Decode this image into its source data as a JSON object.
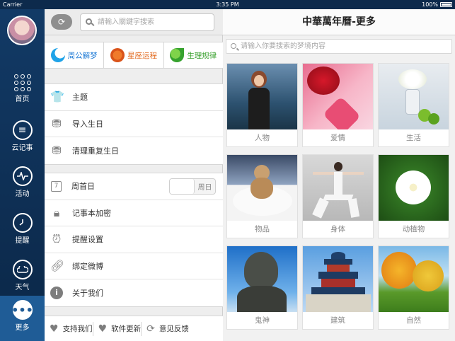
{
  "status_bar": {
    "carrier": "Carrier",
    "time": "3:35 PM",
    "battery": "100%"
  },
  "nav": {
    "items": [
      {
        "label": "首页",
        "icon": "dots-grid-icon"
      },
      {
        "label": "云记事",
        "icon": "list-icon"
      },
      {
        "label": "活动",
        "icon": "pulse-icon"
      },
      {
        "label": "提醒",
        "icon": "clock-icon"
      },
      {
        "label": "天气",
        "icon": "cloud-icon"
      },
      {
        "label": "更多",
        "icon": "more-icon"
      }
    ],
    "active": "更多"
  },
  "middle": {
    "search_placeholder": "請輸入關鍵字搜索",
    "tabs": [
      {
        "label": "周公解梦",
        "icon": "moon-star-icon"
      },
      {
        "label": "星座运程",
        "icon": "planet-icon"
      },
      {
        "label": "生理规律",
        "icon": "leaf-icon"
      }
    ],
    "group1": [
      {
        "label": "主题",
        "icon": "shirt-icon"
      },
      {
        "label": "导入生日",
        "icon": "cake-import-icon"
      },
      {
        "label": "清理重复生日",
        "icon": "cake-clean-icon"
      }
    ],
    "group2": [
      {
        "label": "周首日",
        "icon": "calendar-icon",
        "toggle_value": "周日"
      },
      {
        "label": "记事本加密",
        "icon": "lock-icon"
      },
      {
        "label": "提醒设置",
        "icon": "alarm-icon"
      },
      {
        "label": "绑定微博",
        "icon": "link-icon"
      },
      {
        "label": "关于我们",
        "icon": "info-icon"
      }
    ],
    "bottom": [
      {
        "label": "支持我们",
        "icon": "heart-icon"
      },
      {
        "label": "软件更新",
        "icon": "heart-icon"
      },
      {
        "label": "意见反馈",
        "icon": "refresh-icon"
      }
    ],
    "calendar_day": "7"
  },
  "right": {
    "title": "中華萬年曆-更多",
    "search_placeholder": "请输入你要搜索的梦境内容",
    "tiles": [
      {
        "label": "人物"
      },
      {
        "label": "爱情"
      },
      {
        "label": "生活"
      },
      {
        "label": "物品"
      },
      {
        "label": "身体"
      },
      {
        "label": "动植物"
      },
      {
        "label": "鬼神"
      },
      {
        "label": "建筑"
      },
      {
        "label": "自然"
      }
    ]
  }
}
